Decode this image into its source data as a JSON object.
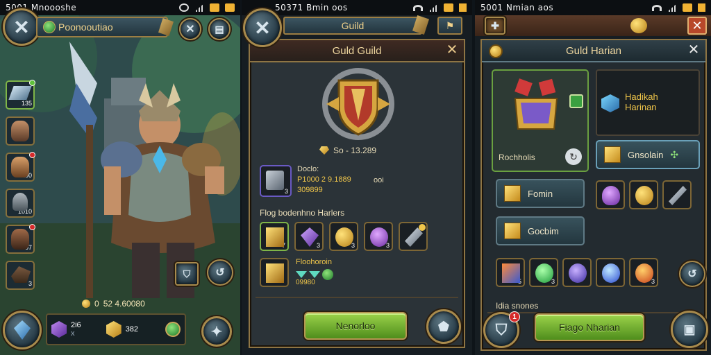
{
  "panel1": {
    "status_time": "5001 Mnoooshe",
    "player_name": "Poonooutiao",
    "side_slots": [
      {
        "count": "135",
        "badge": "green"
      },
      {
        "count": "",
        "badge": "none"
      },
      {
        "count": "100",
        "badge": "red"
      },
      {
        "count": "1010",
        "badge": "none"
      },
      {
        "count": "2007",
        "badge": "red"
      },
      {
        "count": "3",
        "badge": "none"
      }
    ],
    "gold_line": "52 4.60080",
    "gold_prefix": "0",
    "resources": [
      {
        "label": "2i6",
        "sub": "x"
      },
      {
        "label": "382",
        "sub": ""
      }
    ]
  },
  "panel2": {
    "status_time": "50371 Bmin oos",
    "tab_label": "Guild",
    "window_title": "Guld Guild",
    "gold_value": "So  - 13.289",
    "item_label": "Doclo:",
    "item_values": "P1000 2 9.1889",
    "item_sub": "309899",
    "item_extra": "ooi",
    "item_count": "3",
    "section_label": "Flog bodenhno Harlers",
    "grid_counts": [
      "7",
      "3",
      "3",
      "3",
      ""
    ],
    "reward_label": "Floohoroin",
    "reward_sub": "09980",
    "button_label": "Nenorloo",
    "colors": {
      "accent": "#8e7544",
      "button": "#7cb534"
    }
  },
  "panel3": {
    "status_time": "5001 Nmian aos",
    "window_title": "Guld Harian",
    "chest_label": "Rochholis",
    "info_title": "Hadikah\nHarinan",
    "btn_top": "Gnsolain",
    "btn_a": "Fomin",
    "btn_b": "Gocbim",
    "row_counts": [
      "5",
      "3",
      "",
      "",
      "3"
    ],
    "footer_label": "Idia snones",
    "main_button": "Fiago Nharian",
    "notif": "1"
  }
}
